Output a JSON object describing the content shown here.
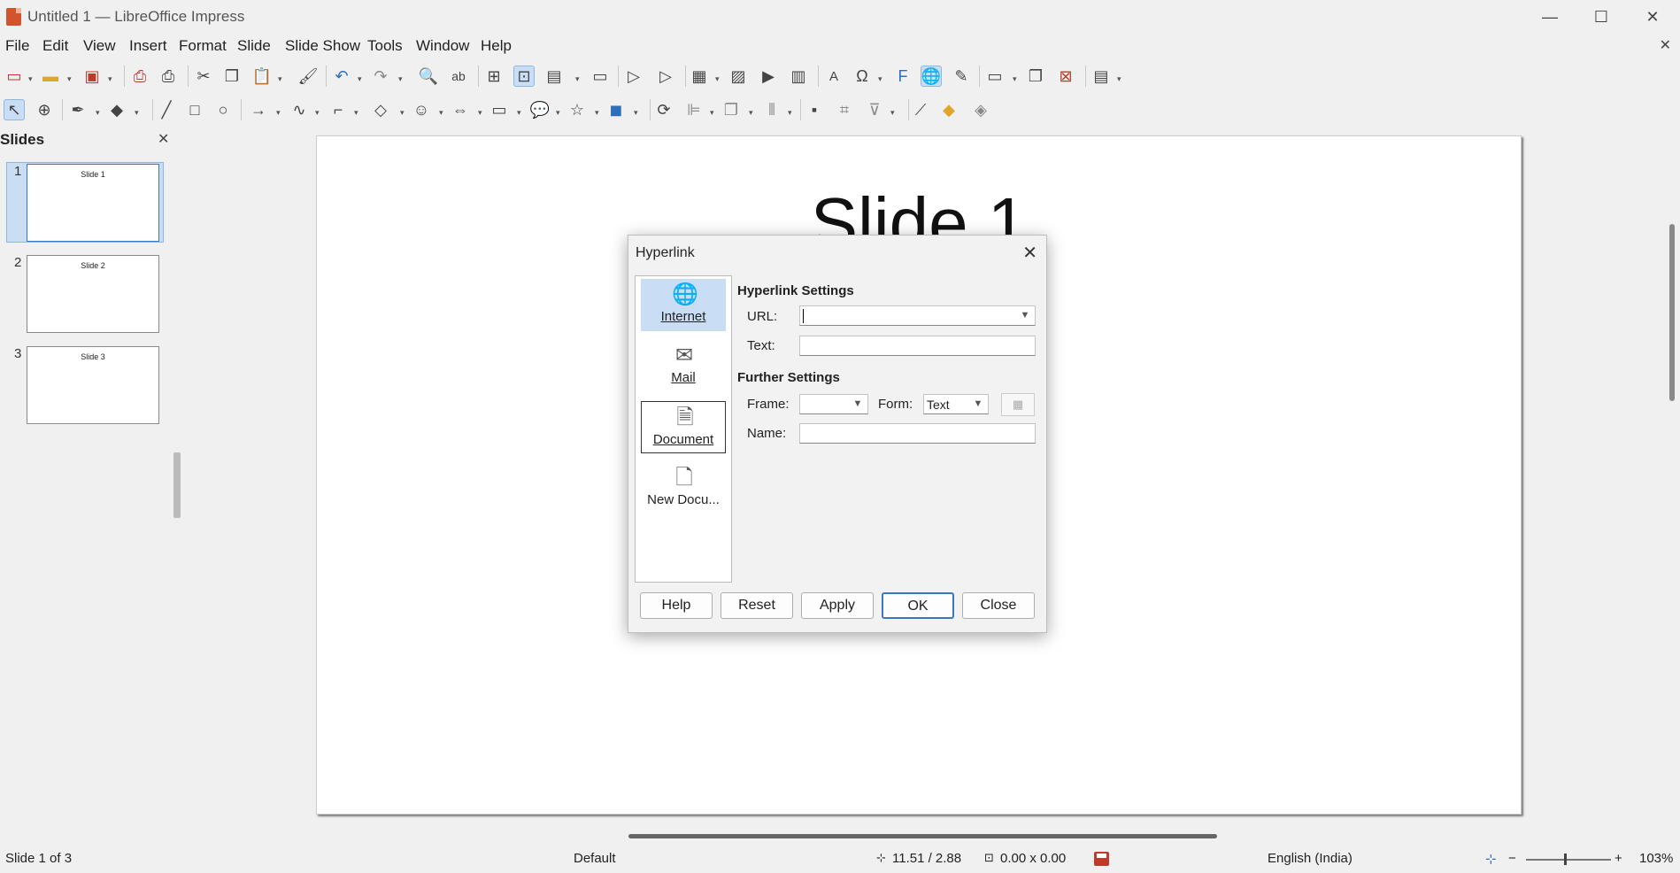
{
  "window": {
    "title": "Untitled 1 — LibreOffice Impress",
    "min": "—",
    "max": "☐",
    "close": "✕"
  },
  "menu": [
    "File",
    "Edit",
    "View",
    "Insert",
    "Format",
    "Slide",
    "Slide Show",
    "Tools",
    "Window",
    "Help"
  ],
  "slides_panel": {
    "title": "Slides",
    "close": "✕",
    "slides": [
      {
        "num": "1",
        "label": "Slide 1"
      },
      {
        "num": "2",
        "label": "Slide 2"
      },
      {
        "num": "3",
        "label": "Slide 3"
      }
    ]
  },
  "slide": {
    "title": "Slide 1"
  },
  "dialog": {
    "title": "Hyperlink",
    "close": "✕",
    "categories": [
      {
        "label": "Internet",
        "icon": "globe-icon"
      },
      {
        "label": "Mail",
        "icon": "mail-icon"
      },
      {
        "label": "Document",
        "icon": "document-icon"
      },
      {
        "label": "New Docu...",
        "icon": "new-document-icon"
      }
    ],
    "hyperlink_settings": {
      "heading": "Hyperlink Settings",
      "url_label": "URL:",
      "url_value": "",
      "text_label": "Text:",
      "text_value": ""
    },
    "further_settings": {
      "heading": "Further Settings",
      "frame_label": "Frame:",
      "frame_value": "",
      "form_label": "Form:",
      "form_value": "Text",
      "name_label": "Name:",
      "name_value": ""
    },
    "buttons": {
      "help": "Help",
      "reset": "Reset",
      "apply": "Apply",
      "ok": "OK",
      "close": "Close"
    }
  },
  "status": {
    "slide": "Slide 1 of 3",
    "layout": "Default",
    "position": "11.51 / 2.88",
    "size": "0.00 x 0.00",
    "language": "English (India)",
    "zoom": "103%"
  }
}
